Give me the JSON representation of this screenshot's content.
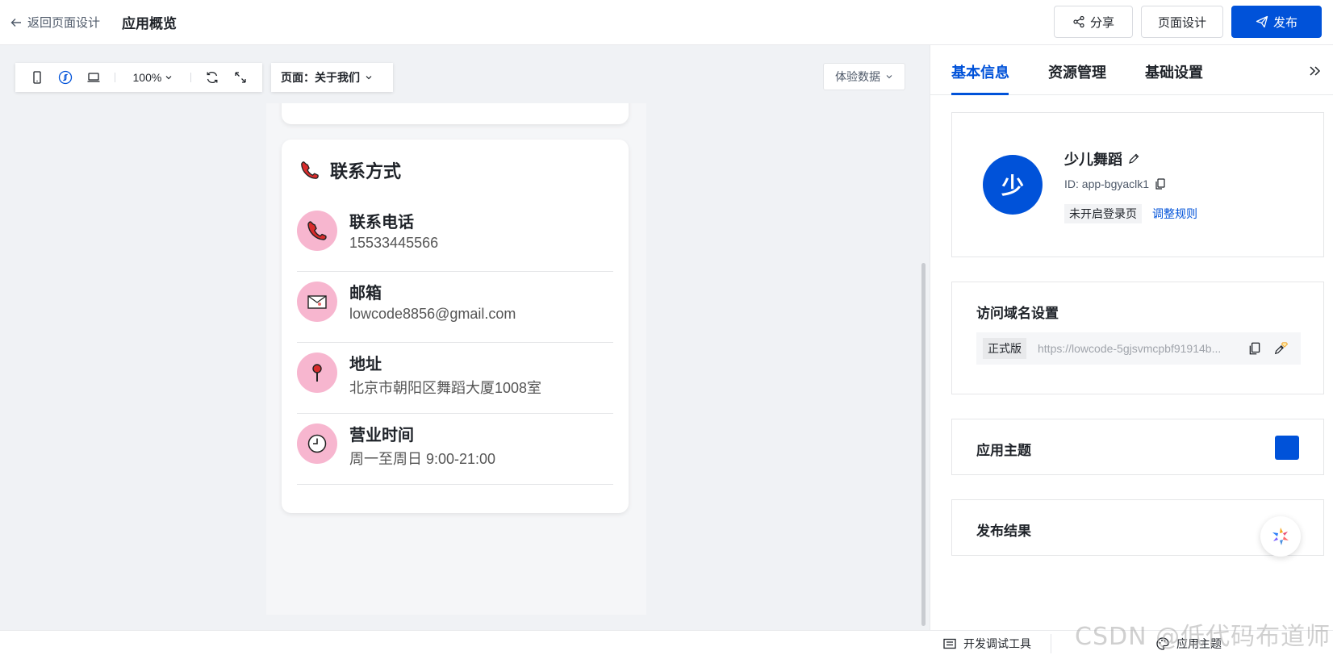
{
  "header": {
    "back_label": "返回页面设计",
    "title": "应用概览",
    "share_label": "分享",
    "design_label": "页面设计",
    "publish_label": "发布"
  },
  "toolbar": {
    "zoom": "100%",
    "page_select": "页面：关于我们",
    "experience_data": "体验数据"
  },
  "contact_card": {
    "title": "联系方式",
    "items": [
      {
        "label": "联系电话",
        "value": "15533445566",
        "icon": "phone-icon"
      },
      {
        "label": "邮箱",
        "value": "lowcode8856@gmail.com",
        "icon": "envelope-icon"
      },
      {
        "label": "地址",
        "value": "北京市朝阳区舞蹈大厦1008室",
        "icon": "pin-icon"
      },
      {
        "label": "营业时间",
        "value": "周一至周日 9:00-21:00",
        "icon": "clock-icon"
      }
    ]
  },
  "panel": {
    "tabs": [
      "基本信息",
      "资源管理",
      "基础设置"
    ],
    "active_tab": "基本信息",
    "app": {
      "avatar_text": "少",
      "name": "少儿舞蹈",
      "id": "ID: app-bgyaclk1",
      "login_status": "未开启登录页",
      "adjust_rule": "调整规则"
    },
    "domain": {
      "title": "访问域名设置",
      "version": "正式版",
      "url": "https://lowcode-5gjsvmcpbf91914b..."
    },
    "theme": {
      "title": "应用主题",
      "color": "#0052d9"
    },
    "publish_result": {
      "title": "发布结果"
    }
  },
  "bottom": {
    "dev_tools": "开发调试工具",
    "app_theme": "应用主题"
  },
  "watermark": "CSDN @低代码布道师",
  "colors": {
    "primary": "#0052d9",
    "icon_bg": "#f7b6cf"
  }
}
